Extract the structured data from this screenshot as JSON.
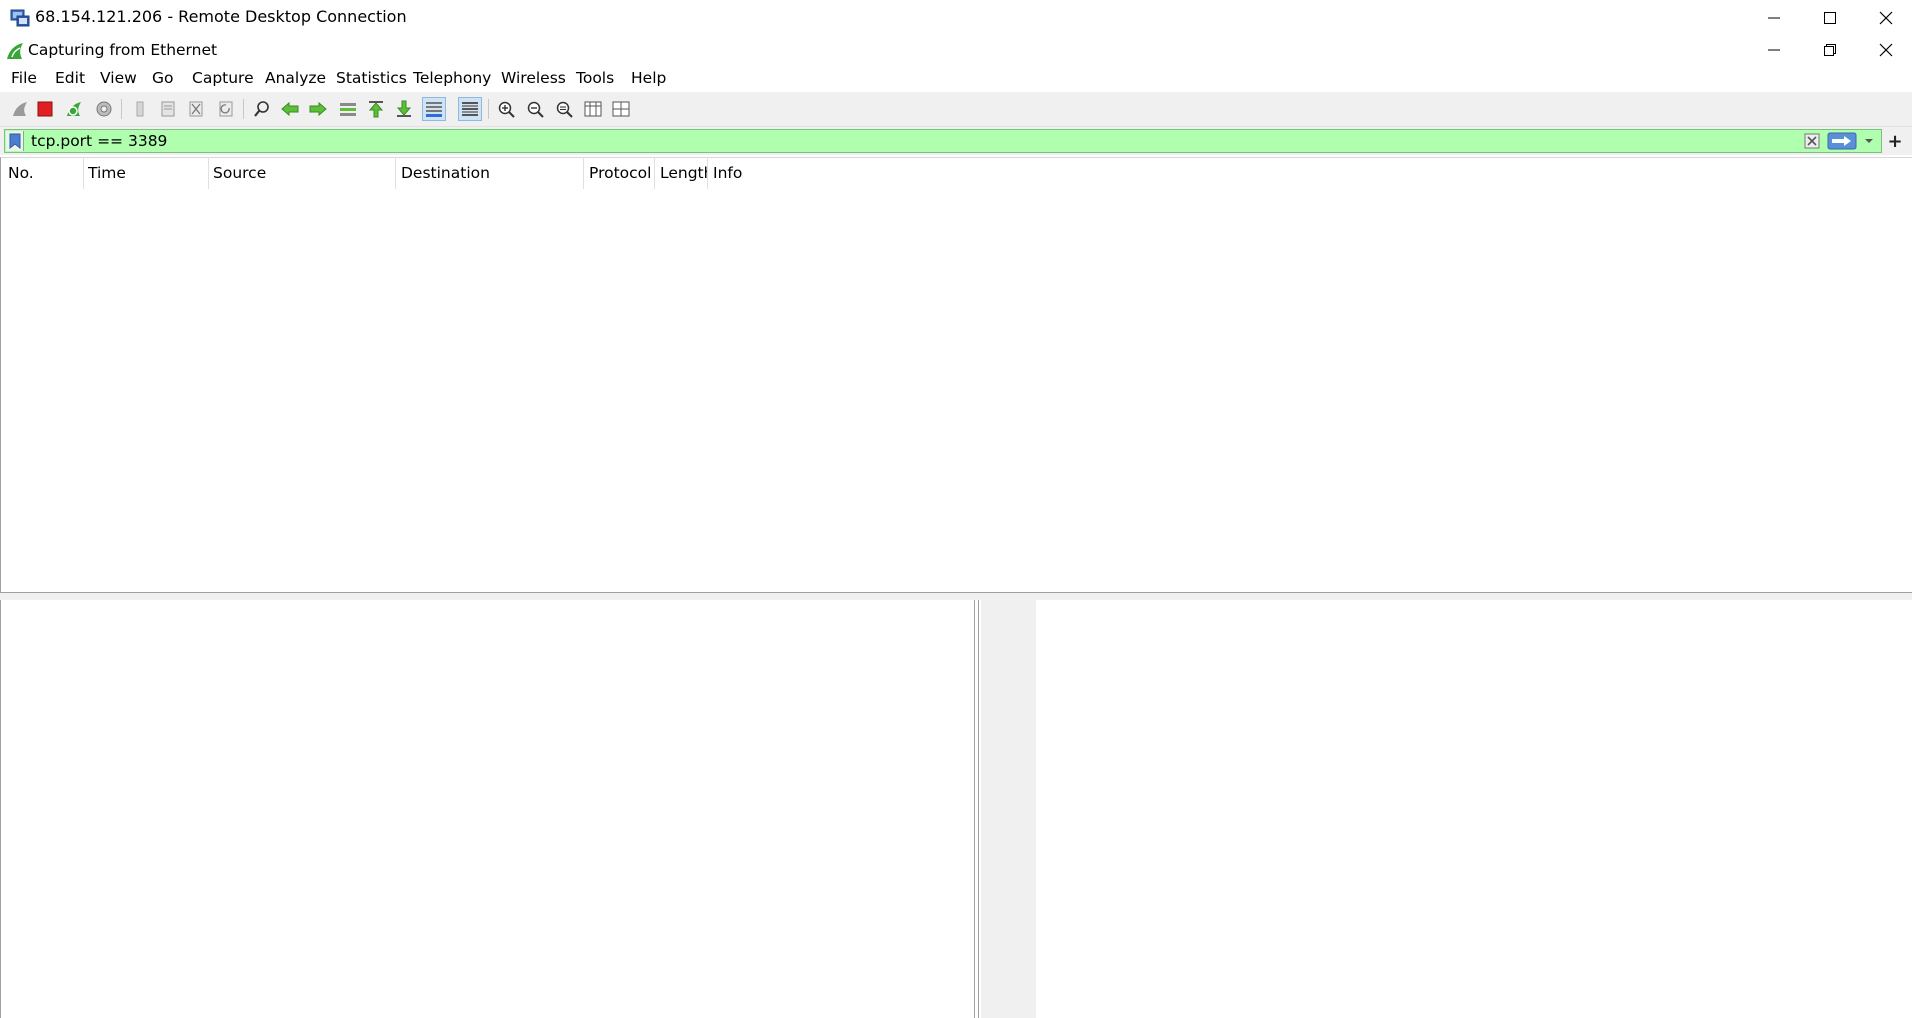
{
  "rdp_window": {
    "title": "68.154.121.206 - Remote Desktop Connection"
  },
  "app_window": {
    "title": "Capturing from Ethernet"
  },
  "menu": {
    "items": [
      "File",
      "Edit",
      "View",
      "Go",
      "Capture",
      "Analyze",
      "Statistics",
      "Telephony",
      "Wireless",
      "Tools",
      "Help"
    ]
  },
  "toolbar": {
    "icons": [
      "start-capture-icon",
      "stop-capture-icon",
      "restart-capture-icon",
      "capture-options-icon",
      "open-file-icon",
      "save-file-icon",
      "close-file-icon",
      "reload-file-icon",
      "find-packet-icon",
      "go-back-icon",
      "go-forward-icon",
      "go-to-packet-icon",
      "go-first-packet-icon",
      "go-last-packet-icon",
      "auto-scroll-icon",
      "colorize-icon",
      "zoom-in-icon",
      "zoom-out-icon",
      "normal-size-icon",
      "resize-columns-icon",
      "layout-icon"
    ]
  },
  "filter": {
    "value": "tcp.port == 3389"
  },
  "packet_list": {
    "columns": [
      "No.",
      "Time",
      "Source",
      "Destination",
      "Protocol",
      "Length",
      "Info"
    ]
  },
  "colors": {
    "filter_valid_bg": "#afffaf",
    "toolbar_bg": "#f0f0f0",
    "stop_red": "#e02020",
    "shark_green": "#3aa63a"
  }
}
